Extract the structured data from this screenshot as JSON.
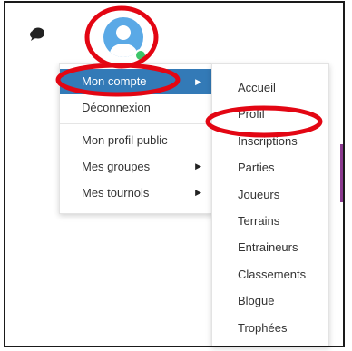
{
  "icons": {
    "chat": "chat-bubble-icon",
    "avatar": "user-avatar-icon",
    "online": "online-status-icon",
    "submenu_caret": "caret-right-icon"
  },
  "colors": {
    "active_bg": "#337ab7",
    "annotation": "#e30613",
    "avatar": "#5aa9e6",
    "online": "#3cc56a",
    "side_accent": "#8b3a8f"
  },
  "menu": {
    "items": [
      {
        "label": "Mon compte",
        "has_submenu": true,
        "active": true
      },
      {
        "label": "Déconnexion",
        "has_submenu": false
      },
      {
        "label": "Mon profil public",
        "has_submenu": false
      },
      {
        "label": "Mes groupes",
        "has_submenu": true
      },
      {
        "label": "Mes tournois",
        "has_submenu": true
      }
    ]
  },
  "submenu": {
    "items": [
      {
        "label": "Accueil"
      },
      {
        "label": "Profil"
      },
      {
        "label": "Inscriptions"
      },
      {
        "label": "Parties"
      },
      {
        "label": "Joueurs"
      },
      {
        "label": "Terrains"
      },
      {
        "label": "Entraineurs"
      },
      {
        "label": "Classements"
      },
      {
        "label": "Blogue"
      },
      {
        "label": "Trophées"
      }
    ]
  }
}
